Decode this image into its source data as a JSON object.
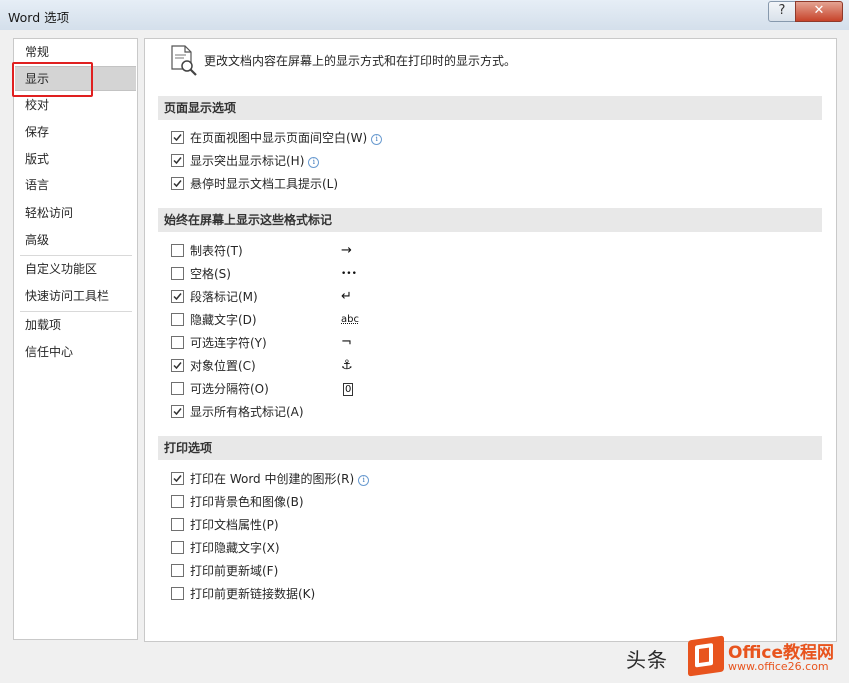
{
  "window": {
    "title": "Word 选项",
    "help_label": "?",
    "close_label": "✕"
  },
  "sidebar": {
    "items": [
      {
        "label": "常规"
      },
      {
        "label": "显示"
      },
      {
        "label": "校对"
      },
      {
        "label": "保存"
      },
      {
        "label": "版式"
      },
      {
        "label": "语言"
      },
      {
        "label": "轻松访问"
      },
      {
        "label": "高级"
      },
      {
        "label": "自定义功能区"
      },
      {
        "label": "快速访问工具栏"
      },
      {
        "label": "加载项"
      },
      {
        "label": "信任中心"
      }
    ],
    "selected": "显示"
  },
  "main": {
    "header": "更改文档内容在屏幕上的显示方式和在打印时的显示方式。",
    "sections": [
      {
        "title": "页面显示选项",
        "options": [
          {
            "label": "在页面视图中显示页面间空白(W)",
            "checked": true,
            "info": true
          },
          {
            "label": "显示突出显示标记(H)",
            "checked": true,
            "info": true
          },
          {
            "label": "悬停时显示文档工具提示(L)",
            "checked": true,
            "info": false
          }
        ]
      },
      {
        "title": "始终在屏幕上显示这些格式标记",
        "options": [
          {
            "label": "制表符(T)",
            "checked": false,
            "symbol": "→"
          },
          {
            "label": "空格(S)",
            "checked": false,
            "symbol": "•••"
          },
          {
            "label": "段落标记(M)",
            "checked": true,
            "symbol": "↵"
          },
          {
            "label": "隐藏文字(D)",
            "checked": false,
            "symbol": "abc"
          },
          {
            "label": "可选连字符(Y)",
            "checked": false,
            "symbol": "¬"
          },
          {
            "label": "对象位置(C)",
            "checked": true,
            "symbol": "⚓"
          },
          {
            "label": "可选分隔符(O)",
            "checked": false,
            "symbol": "0"
          },
          {
            "label": "显示所有格式标记(A)",
            "checked": true,
            "symbol": ""
          }
        ]
      },
      {
        "title": "打印选项",
        "options": [
          {
            "label": "打印在 Word 中创建的图形(R)",
            "checked": true,
            "info": true
          },
          {
            "label": "打印背景色和图像(B)",
            "checked": false
          },
          {
            "label": "打印文档属性(P)",
            "checked": false
          },
          {
            "label": "打印隐藏文字(X)",
            "checked": false
          },
          {
            "label": "打印前更新域(F)",
            "checked": false
          },
          {
            "label": "打印前更新链接数据(K)",
            "checked": false
          }
        ]
      }
    ]
  },
  "watermark": {
    "text1": "头条",
    "brand": "Office教程网",
    "url": "www.office26.com"
  },
  "colors": {
    "highlight": "#e02020",
    "brand": "#e8541e",
    "section_bg": "#e8e8e8"
  }
}
